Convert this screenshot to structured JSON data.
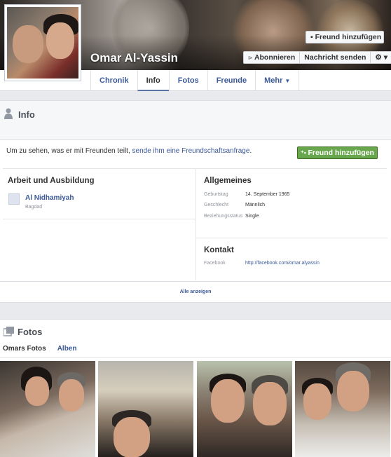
{
  "profile": {
    "name": "Omar Al-Yassin"
  },
  "header_buttons": {
    "add_friend": "Freund hinzufügen",
    "subscribe": "Abonnieren",
    "send_message": "Nachricht senden",
    "settings": "⚙ ▾"
  },
  "tabs": [
    {
      "label": "Chronik"
    },
    {
      "label": "Info"
    },
    {
      "label": "Fotos"
    },
    {
      "label": "Freunde"
    },
    {
      "label": "Mehr"
    }
  ],
  "info": {
    "title": "Info",
    "friend_line_prefix": "Um zu sehen, was er mit Freunden teilt, ",
    "friend_line_link": "sende ihm eine Freundschaftsanfrage",
    "friend_line_suffix": ".",
    "add_friend_button": "Freund hinzufügen",
    "work": {
      "title": "Arbeit und Ausbildung",
      "name": "Al Nidhamiyah",
      "location": "Bagdad"
    },
    "general": {
      "title": "Allgemeines",
      "rows": [
        {
          "key": "Geburtstag",
          "value": "14. September 1965"
        },
        {
          "key": "Geschlecht",
          "value": "Männlich"
        },
        {
          "key": "Beziehungsstatus",
          "value": "Single"
        }
      ]
    },
    "contact": {
      "title": "Kontakt",
      "key": "Facebook",
      "value": "http://facebook.com/omar.alyassin"
    },
    "show_all": "Alle anzeigen"
  },
  "photos": {
    "title": "Fotos",
    "tab_own": "Omars Fotos",
    "tab_albums": "Alben"
  },
  "colors": {
    "link": "#3b5998",
    "green_button": "#69a74e"
  }
}
